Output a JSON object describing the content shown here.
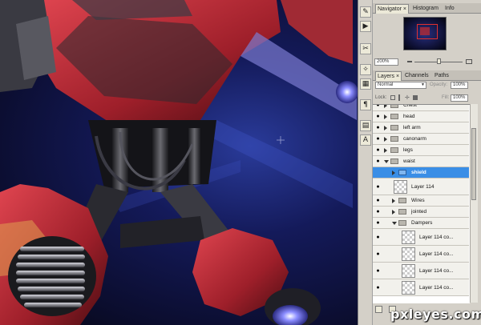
{
  "tools": [
    {
      "name": "history-brush-icon",
      "glyph": "✎"
    },
    {
      "name": "actions-play-icon",
      "glyph": "▶"
    },
    {
      "name": "crop-tool-icon",
      "glyph": "✂"
    },
    {
      "name": "brush-presets-icon",
      "glyph": "✧"
    },
    {
      "name": "swatches-icon",
      "glyph": "▦"
    },
    {
      "name": "paragraph-icon",
      "glyph": "¶"
    },
    {
      "name": "layer-comps-icon",
      "glyph": "▤"
    },
    {
      "name": "character-icon",
      "glyph": "A"
    }
  ],
  "navigator": {
    "tabs": [
      "Navigator",
      "Histogram",
      "Info"
    ],
    "close_glyph": "×",
    "zoom": "200%"
  },
  "layers_panel": {
    "tabs": [
      "Layers",
      "Channels",
      "Paths"
    ],
    "close_glyph": "×",
    "blend_mode": "Normal",
    "opacity_label": "Opacity:",
    "opacity_value": "100%",
    "lock_label": "Lock:",
    "fill_label": "Fill:",
    "fill_value": "100%",
    "eye_glyph": "●",
    "layers": [
      {
        "name": "Chest",
        "kind": "group",
        "indent": 0,
        "open": false,
        "selected": false,
        "visible": true
      },
      {
        "name": "head",
        "kind": "group",
        "indent": 0,
        "open": false,
        "selected": false,
        "visible": true
      },
      {
        "name": "left arm",
        "kind": "group",
        "indent": 0,
        "open": false,
        "selected": false,
        "visible": true
      },
      {
        "name": "canonarm",
        "kind": "group",
        "indent": 0,
        "open": false,
        "selected": false,
        "visible": true
      },
      {
        "name": "legs",
        "kind": "group",
        "indent": 0,
        "open": false,
        "selected": false,
        "visible": true
      },
      {
        "name": "waist",
        "kind": "group",
        "indent": 0,
        "open": true,
        "selected": false,
        "visible": true
      },
      {
        "name": "shield",
        "kind": "group",
        "indent": 1,
        "open": false,
        "selected": true,
        "visible": false
      },
      {
        "name": "Layer 114",
        "kind": "layer",
        "indent": 1,
        "open": false,
        "selected": false,
        "visible": true
      },
      {
        "name": "Wires",
        "kind": "group",
        "indent": 1,
        "open": false,
        "selected": false,
        "visible": true
      },
      {
        "name": "jointed",
        "kind": "group",
        "indent": 1,
        "open": false,
        "selected": false,
        "visible": true
      },
      {
        "name": "Dampers",
        "kind": "group",
        "indent": 1,
        "open": true,
        "selected": false,
        "visible": true
      },
      {
        "name": "Layer 114 co...",
        "kind": "layer",
        "indent": 2,
        "open": false,
        "selected": false,
        "visible": true
      },
      {
        "name": "Layer 114 co...",
        "kind": "layer",
        "indent": 2,
        "open": false,
        "selected": false,
        "visible": true
      },
      {
        "name": "Layer 114 co...",
        "kind": "layer",
        "indent": 2,
        "open": false,
        "selected": false,
        "visible": true
      },
      {
        "name": "Layer 114 co...",
        "kind": "layer",
        "indent": 2,
        "open": false,
        "selected": false,
        "visible": true
      }
    ]
  },
  "watermark": "pxleyes.com",
  "colors": {
    "selection": "#3a8ee6",
    "robot_red": "#c0303a",
    "background_blue": "#141a5a"
  }
}
